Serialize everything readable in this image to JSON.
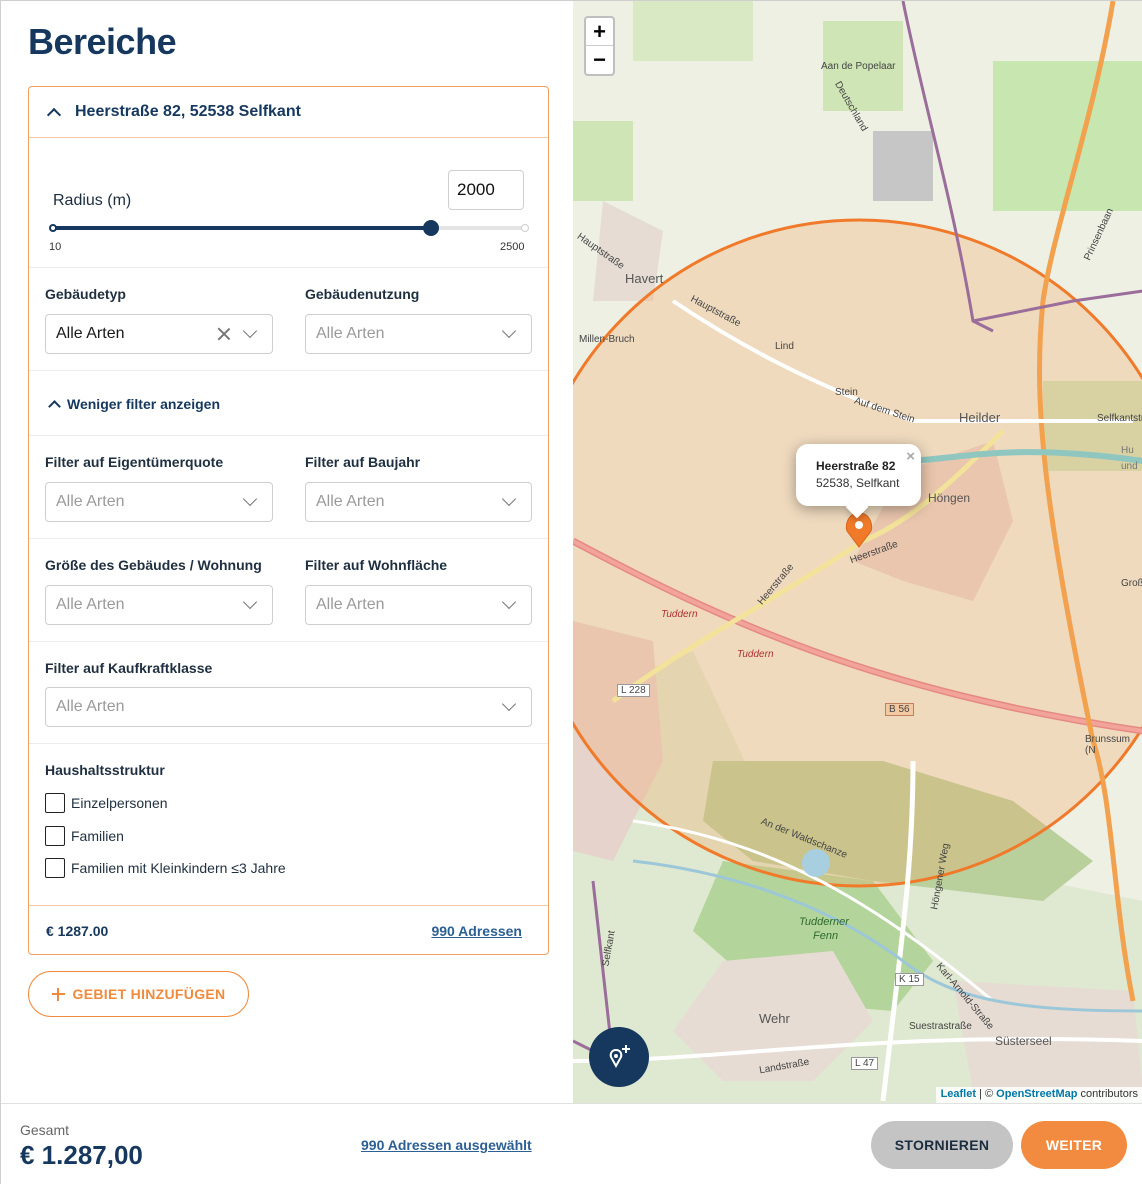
{
  "page": {
    "title": "Bereiche"
  },
  "area_card": {
    "address": "Heerstraße 82, 52538 Selfkant",
    "radius": {
      "label": "Radius (m)",
      "value": "2000",
      "min": "10",
      "max": "2500",
      "fraction": 0.8
    },
    "gebaeudetyp": {
      "label": "Gebäudetyp",
      "value": "Alle Arten"
    },
    "gebaeudenutzung": {
      "label": "Gebäudenutzung",
      "placeholder": "Alle Arten"
    },
    "toggle_filters": "Weniger filter anzeigen",
    "eigentuemerquote": {
      "label": "Filter auf Eigentümerquote",
      "placeholder": "Alle Arten"
    },
    "baujahr": {
      "label": "Filter auf Baujahr",
      "placeholder": "Alle Arten"
    },
    "groesse": {
      "label": "Größe des Gebäudes / Wohnung",
      "placeholder": "Alle Arten"
    },
    "wohnflaeche": {
      "label": "Filter auf Wohnfläche",
      "placeholder": "Alle Arten"
    },
    "kaufkraft": {
      "label": "Filter auf Kaufkraftklasse",
      "placeholder": "Alle Arten"
    },
    "haushalt": {
      "label": "Haushaltsstruktur",
      "options": [
        "Einzelpersonen",
        "Familien",
        "Familien mit Kleinkindern ≤3 Jahre"
      ]
    },
    "price": "€ 1287.00",
    "addresses": "990 Adressen"
  },
  "add_area_button": "GEBIET HINZUFÜGEN",
  "map": {
    "zoom_in": "+",
    "zoom_out": "−",
    "popup_title": "Heerstraße 82",
    "popup_sub": "52538, Selfkant",
    "popup_close": "×",
    "attribution_leaflet": "Leaflet",
    "attribution_sep": " | © ",
    "attribution_osm": "OpenStreetMap",
    "attribution_tail": " contributors",
    "labels": {
      "popelaar": "Aan de Popelaar",
      "deutschland": "Deutschland",
      "hauptstrasse1": "Hauptstraße",
      "havert": "Havert",
      "millen": "Millen-Bruch",
      "hauptstrasse2": "Hauptstraße",
      "lind": "Lind",
      "stein": "Stein",
      "aufdemstein": "Auf dem Stein",
      "heilder": "Heilder",
      "selfkantstr": "Selfkantstr",
      "hongen": "Höngen",
      "heerstrasse_a": "Heerstraße",
      "heerstrasse_b": "Heerstraße",
      "tuddern1": "Tuddern",
      "tuddern2": "Tuddern",
      "l228": "L 228",
      "b56": "B 56",
      "brunssum": "Brunssum (N",
      "waldschanze": "An der Waldschanze",
      "tudderner": "Tudderner",
      "fenn": "Fenn",
      "k15": "K 15",
      "wehr": "Wehr",
      "suestr": "Suestrastraße",
      "susterseel": "Süsterseel",
      "l47": "L 47",
      "landstrasse": "Landstraße",
      "selfkant_v": "Selfkant",
      "prinsenbaan": "Prinsenbaan",
      "hongenerweg": "Höngener Weg",
      "karlarnold": "Karl-Arnold-Straße",
      "gro": "Groß",
      "hu": "Hu",
      "und": "und"
    }
  },
  "footer": {
    "total_label": "Gesamt",
    "total_value": "€ 1.287,00",
    "selected": "990 Adressen ausgewählt",
    "cancel": "STORNIEREN",
    "next": "WEITER"
  },
  "colors": {
    "brand": "#16385e",
    "accent": "#f28b3f",
    "link": "#2c5f93"
  }
}
